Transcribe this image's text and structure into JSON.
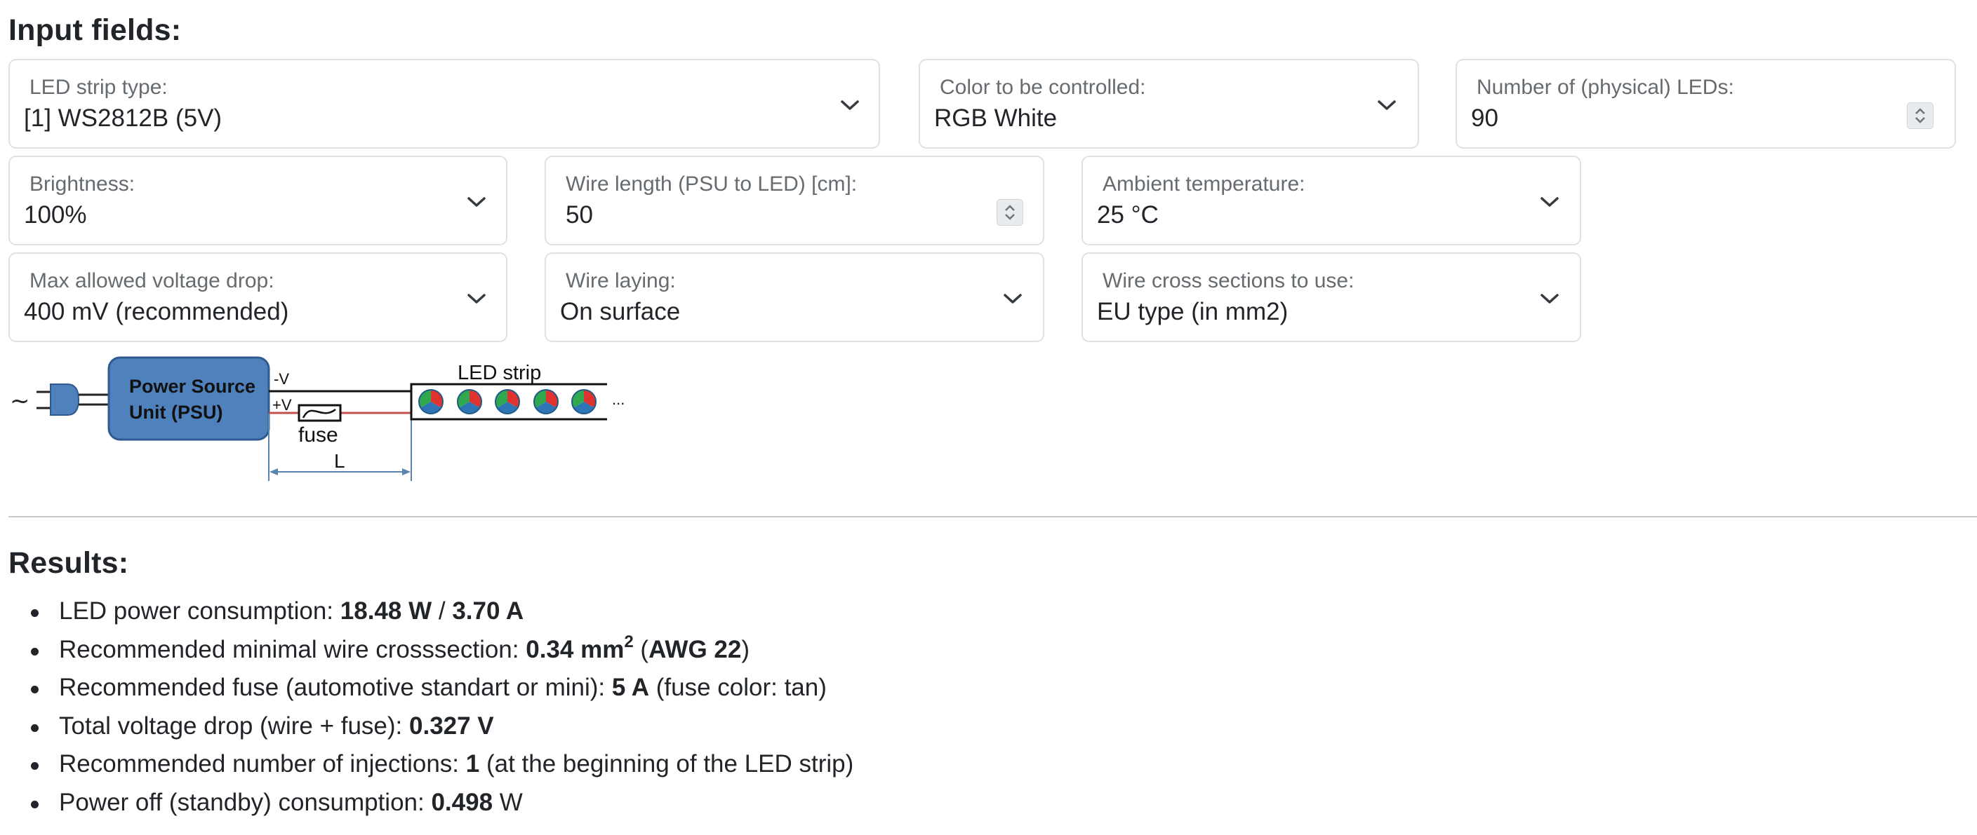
{
  "headings": {
    "inputs": "Input fields:",
    "results": "Results:"
  },
  "fields": {
    "led_strip_type": {
      "label": "LED strip type:",
      "value": "[1] WS2812B (5V)"
    },
    "color": {
      "label": "Color to be controlled:",
      "value": "RGB White"
    },
    "num_leds": {
      "label": "Number of (physical) LEDs:",
      "value": "90"
    },
    "brightness": {
      "label": "Brightness:",
      "value": "100%"
    },
    "wire_length": {
      "label": "Wire length (PSU to LED) [cm]:",
      "value": "50"
    },
    "ambient_temp": {
      "label": "Ambient temperature:",
      "value": "25 °C"
    },
    "max_drop": {
      "label": "Max allowed voltage drop:",
      "value": "400 mV (recommended)"
    },
    "wire_laying": {
      "label": "Wire laying:",
      "value": "On surface"
    },
    "cross_sections": {
      "label": "Wire cross sections to use:",
      "value": "EU type (in mm2)"
    }
  },
  "diagram": {
    "tilde": "~",
    "psu_line1": "Power Source",
    "psu_line2": "Unit (PSU)",
    "minus_v": "-V",
    "plus_v": "+V",
    "fuse": "fuse",
    "led_strip": "LED strip",
    "length": "L",
    "ellipsis": "..."
  },
  "results": {
    "power": {
      "label": "LED power consumption: ",
      "watts": "18.48 W",
      "sep": " / ",
      "amps": "3.70 A"
    },
    "wire": {
      "label": "Recommended minimal wire crosssection: ",
      "value": "0.34 mm",
      "sup": "2",
      "open": " (",
      "awg": "AWG 22",
      "close": ")"
    },
    "fuse": {
      "label": "Recommended fuse (automotive standart or mini): ",
      "value": "5 A",
      "note": " (fuse color: tan)"
    },
    "drop": {
      "label": "Total voltage drop (wire + fuse): ",
      "value": "0.327 V"
    },
    "injections": {
      "label": "Recommended number of injections: ",
      "value": "1",
      "note": " (at the beginning of the LED strip)"
    },
    "standby": {
      "label": "Power off (standby) consumption: ",
      "value": "0.498",
      "unit": " W"
    }
  }
}
